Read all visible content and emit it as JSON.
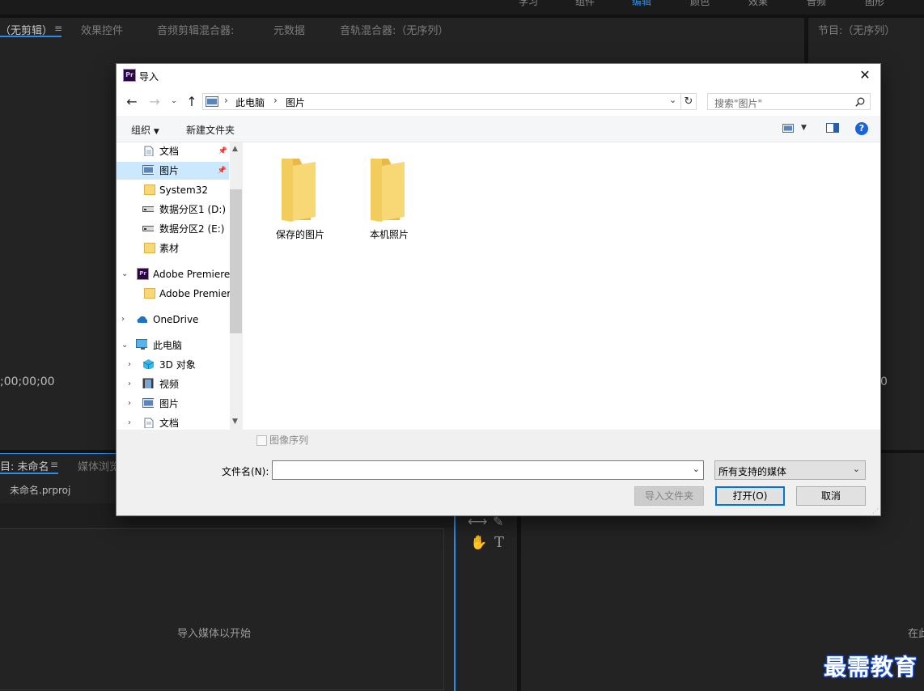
{
  "premiere": {
    "workspaces": [
      "学习",
      "组件",
      "编辑",
      "颜色",
      "效果",
      "音频",
      "图形"
    ],
    "source_tabs": [
      "（无剪辑）",
      "效果控件",
      "音频剪辑混合器:",
      "元数据",
      "音轨混合器:（无序列）"
    ],
    "program_tab": "节目:（无序列）",
    "source_timecode": ";00;00;00",
    "program_timecode": "0",
    "project_tabs": [
      "目: 未命名",
      "媒体浏览"
    ],
    "project_file": "未命名.prproj",
    "project_empty_text": "导入媒体以开始",
    "timeline_hint": "在此"
  },
  "dialog": {
    "title": "导入",
    "app_icon_text": "Pr",
    "address": [
      "此电脑",
      "图片"
    ],
    "search_placeholder": "搜索\"图片\"",
    "organize": "组织",
    "new_folder": "新建文件夹",
    "nav_items": [
      {
        "label": "文档",
        "icon": "document-icon",
        "pinned": true
      },
      {
        "label": "图片",
        "icon": "pictures-icon",
        "pinned": true,
        "selected": true
      },
      {
        "label": "System32",
        "icon": "folder-icon"
      },
      {
        "label": "数据分区1 (D:)",
        "icon": "drive-icon"
      },
      {
        "label": "数据分区2 (E:)",
        "icon": "drive-icon"
      },
      {
        "label": "素材",
        "icon": "folder-icon"
      },
      {
        "label": "Adobe Premiere",
        "icon": "premiere-icon",
        "expanded": true
      },
      {
        "label": "Adobe Premier",
        "icon": "folder-icon"
      },
      {
        "label": "OneDrive",
        "icon": "onedrive-icon",
        "collapsed": true
      },
      {
        "label": "此电脑",
        "icon": "pc-icon",
        "expanded": true
      },
      {
        "label": "3D 对象",
        "icon": "3d-icon",
        "collapsed": true
      },
      {
        "label": "视频",
        "icon": "video-icon",
        "collapsed": true
      },
      {
        "label": "图片",
        "icon": "pictures-icon",
        "collapsed": true
      },
      {
        "label": "文档",
        "icon": "document-icon",
        "collapsed": true
      }
    ],
    "folders": [
      "保存的图片",
      "本机照片"
    ],
    "image_sequence": "图像序列",
    "filename_label": "文件名(N):",
    "filename_value": "",
    "filetype": "所有支持的媒体",
    "import_folder_btn": "导入文件夹",
    "open_btn": "打开(O)",
    "cancel_btn": "取消"
  },
  "watermark": "最需教育"
}
